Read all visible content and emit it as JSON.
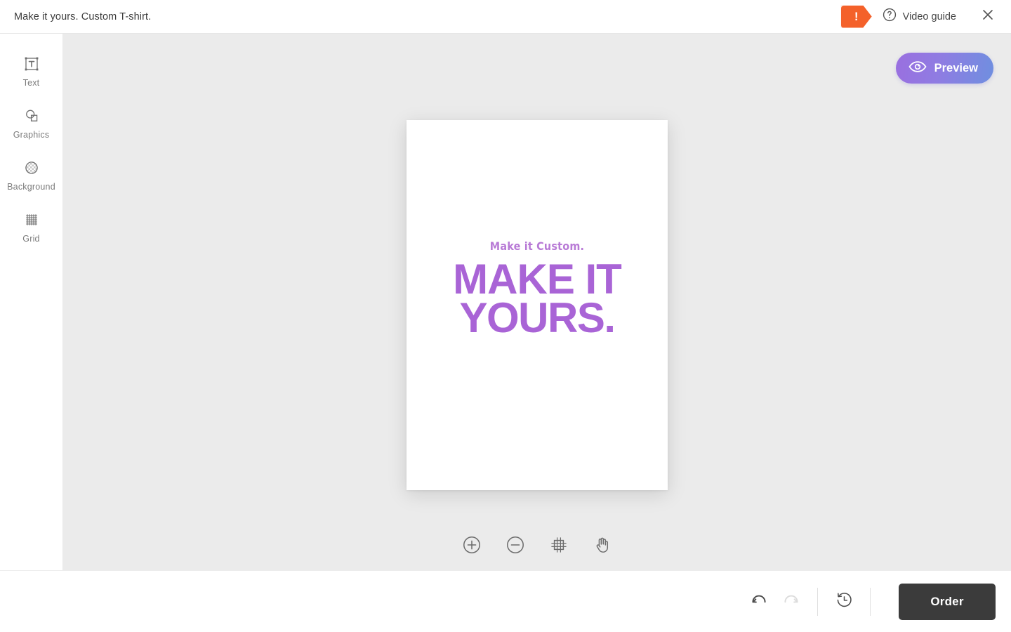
{
  "topbar": {
    "document_title": "Make it yours. Custom T-shirt.",
    "alert_badge": "!",
    "alert_icon_name": "alert-exclamation-badge",
    "help_icon_name": "question-circle-icon",
    "video_guide_label": "Video guide",
    "close_icon_name": "close-icon"
  },
  "sidebar": {
    "items": [
      {
        "label": "Text",
        "icon": "text-box-icon"
      },
      {
        "label": "Graphics",
        "icon": "shapes-icon"
      },
      {
        "label": "Background",
        "icon": "checkered-circle-icon"
      },
      {
        "label": "Grid",
        "icon": "grid-icon"
      }
    ]
  },
  "canvas": {
    "preview_button_label": "Preview",
    "preview_icon_name": "eye-icon",
    "design": {
      "subtitle": "Make it Custom.",
      "headline_line1": "MAKE IT",
      "headline_line2": "YOURS.",
      "text_color": "#a964d6",
      "subtitle_color": "#b87ad6",
      "background_color": "#ffffff"
    },
    "stage_background": "#ebebeb",
    "zoom_tools": [
      {
        "name": "zoom-in",
        "icon": "plus-circle-icon"
      },
      {
        "name": "zoom-out",
        "icon": "minus-circle-icon"
      },
      {
        "name": "fit-to-screen",
        "icon": "crosshair-frame-icon"
      },
      {
        "name": "pan",
        "icon": "hand-icon"
      }
    ]
  },
  "bottombar": {
    "undo_icon_name": "undo-arrow-icon",
    "redo_icon_name": "redo-arrow-icon",
    "redo_disabled": true,
    "history_icon_name": "clock-history-icon",
    "order_button_label": "Order"
  },
  "colors": {
    "accent_orange": "#f4612a",
    "preview_gradient_start": "#9a6fe0",
    "preview_gradient_end": "#6f8fe0",
    "order_button": "#3b3b3b",
    "design_purple": "#a964d6"
  }
}
